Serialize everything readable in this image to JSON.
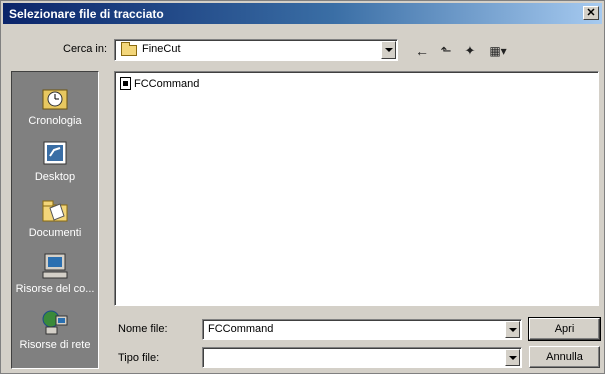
{
  "window": {
    "title": "Selezionare file di tracciato",
    "close_glyph": "✕"
  },
  "lookin": {
    "label": "Cerca in:",
    "value": "FineCut",
    "folder_icon": "folder-icon"
  },
  "toolbar": {
    "back_icon": "←",
    "up_icon": "⬑",
    "new_folder_icon": "✦",
    "view_menu_icon": "▦▾"
  },
  "places": [
    {
      "label": "Cronologia",
      "icon": "history-icon"
    },
    {
      "label": "Desktop",
      "icon": "desktop-icon"
    },
    {
      "label": "Documenti",
      "icon": "documents-icon"
    },
    {
      "label": "Risorse del co...",
      "icon": "my-computer-icon"
    },
    {
      "label": "Risorse di rete",
      "icon": "network-icon"
    }
  ],
  "files": [
    {
      "name": "FCCommand",
      "icon": "file-icon"
    }
  ],
  "filename": {
    "label": "Nome file:",
    "value": "FCCommand"
  },
  "filetype": {
    "label": "Tipo file:",
    "value": ""
  },
  "buttons": {
    "open": "Apri",
    "cancel": "Annulla"
  },
  "colors": {
    "title_start": "#0a246a",
    "title_end": "#a6caf0",
    "dialog_face": "#d4d0c8",
    "places_bar": "#808080"
  }
}
